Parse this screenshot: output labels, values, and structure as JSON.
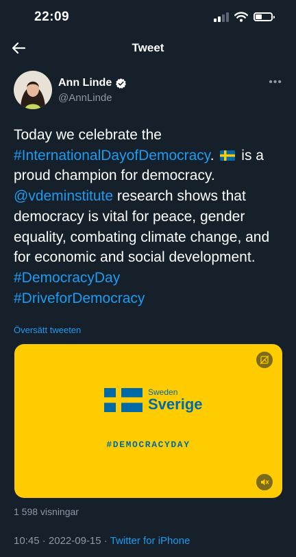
{
  "status_bar": {
    "time": "22:09"
  },
  "header": {
    "title": "Tweet"
  },
  "author": {
    "name": "Ann Linde",
    "handle": "@AnnLinde",
    "verified_icon": "verified-badge-icon"
  },
  "tweet": {
    "t1": "Today we celebrate the ",
    "hashtag1": "#InternationalDayofDemocracy",
    "t2": ". ",
    "t3": " is a proud champion for democracy. ",
    "mention": "@vdeminstitute",
    "t4": " research shows that democracy is vital for peace, gender equality, combating climate change, and for economic and social development. ",
    "hashtag2": "#DemocracyDay",
    "hashtag3": "#DriveforDemocracy"
  },
  "translate_label": "Översätt tweeten",
  "media": {
    "logo_small": "Sweden",
    "logo_big": "Sverige",
    "hashtag": "#DEMOCRACYDAY",
    "background_color": "#fecc00",
    "text_color": "#006aa7"
  },
  "views": "1 598 visningar",
  "meta": {
    "time": "10:45",
    "sep1": " · ",
    "date": "2022-09-15",
    "sep2": " · ",
    "source": "Twitter for iPhone"
  },
  "colors": {
    "background": "#15202b",
    "link": "#1d9bf0",
    "secondary_text": "#8b98a5"
  }
}
